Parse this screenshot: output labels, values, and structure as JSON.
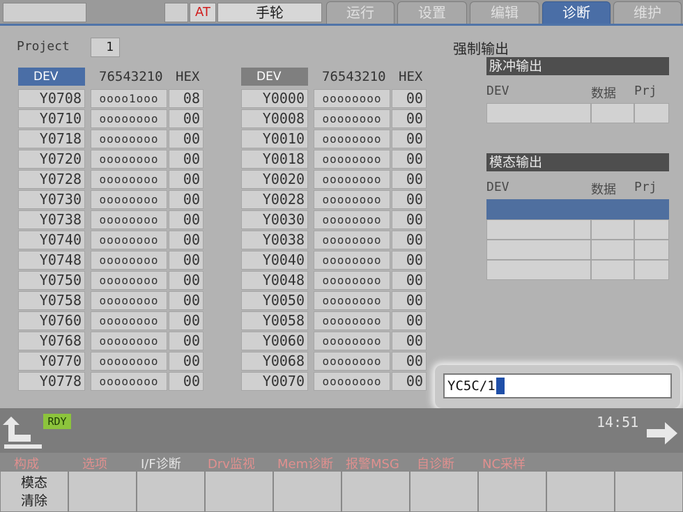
{
  "topbar": {
    "at_label": "AT",
    "mode_label": "手轮",
    "tabs": [
      {
        "label": "运行",
        "active": false
      },
      {
        "label": "设置",
        "active": false
      },
      {
        "label": "编辑",
        "active": false
      },
      {
        "label": "诊断",
        "active": true
      },
      {
        "label": "维护",
        "active": false
      }
    ]
  },
  "project": {
    "label": "Project",
    "value": "1"
  },
  "io_left": {
    "headers": {
      "dev": "DEV",
      "bits": "76543210",
      "hex": "HEX"
    },
    "rows": [
      {
        "dev": "Y0708",
        "bits": "oooo1ooo",
        "hex": "08"
      },
      {
        "dev": "Y0710",
        "bits": "oooooooo",
        "hex": "00"
      },
      {
        "dev": "Y0718",
        "bits": "oooooooo",
        "hex": "00"
      },
      {
        "dev": "Y0720",
        "bits": "oooooooo",
        "hex": "00"
      },
      {
        "dev": "Y0728",
        "bits": "oooooooo",
        "hex": "00"
      },
      {
        "dev": "Y0730",
        "bits": "oooooooo",
        "hex": "00"
      },
      {
        "dev": "Y0738",
        "bits": "oooooooo",
        "hex": "00"
      },
      {
        "dev": "Y0740",
        "bits": "oooooooo",
        "hex": "00"
      },
      {
        "dev": "Y0748",
        "bits": "oooooooo",
        "hex": "00"
      },
      {
        "dev": "Y0750",
        "bits": "oooooooo",
        "hex": "00"
      },
      {
        "dev": "Y0758",
        "bits": "oooooooo",
        "hex": "00"
      },
      {
        "dev": "Y0760",
        "bits": "oooooooo",
        "hex": "00"
      },
      {
        "dev": "Y0768",
        "bits": "oooooooo",
        "hex": "00"
      },
      {
        "dev": "Y0770",
        "bits": "oooooooo",
        "hex": "00"
      },
      {
        "dev": "Y0778",
        "bits": "oooooooo",
        "hex": "00"
      }
    ]
  },
  "io_right": {
    "headers": {
      "dev": "DEV",
      "bits": "76543210",
      "hex": "HEX"
    },
    "rows": [
      {
        "dev": "Y0000",
        "bits": "oooooooo",
        "hex": "00"
      },
      {
        "dev": "Y0008",
        "bits": "oooooooo",
        "hex": "00"
      },
      {
        "dev": "Y0010",
        "bits": "oooooooo",
        "hex": "00"
      },
      {
        "dev": "Y0018",
        "bits": "oooooooo",
        "hex": "00"
      },
      {
        "dev": "Y0020",
        "bits": "oooooooo",
        "hex": "00"
      },
      {
        "dev": "Y0028",
        "bits": "oooooooo",
        "hex": "00"
      },
      {
        "dev": "Y0030",
        "bits": "oooooooo",
        "hex": "00"
      },
      {
        "dev": "Y0038",
        "bits": "oooooooo",
        "hex": "00"
      },
      {
        "dev": "Y0040",
        "bits": "oooooooo",
        "hex": "00"
      },
      {
        "dev": "Y0048",
        "bits": "oooooooo",
        "hex": "00"
      },
      {
        "dev": "Y0050",
        "bits": "oooooooo",
        "hex": "00"
      },
      {
        "dev": "Y0058",
        "bits": "oooooooo",
        "hex": "00"
      },
      {
        "dev": "Y0060",
        "bits": "oooooooo",
        "hex": "00"
      },
      {
        "dev": "Y0068",
        "bits": "oooooooo",
        "hex": "00"
      },
      {
        "dev": "Y0070",
        "bits": "oooooooo",
        "hex": "00"
      }
    ]
  },
  "forced_output": {
    "title": "强制输出",
    "pulse_section": {
      "title": "脉冲输出",
      "col_dev": "DEV",
      "col_data": "数据",
      "col_prj": "Prj"
    },
    "modal_section": {
      "title": "模态输出",
      "col_dev": "DEV",
      "col_data": "数据",
      "col_prj": "Prj"
    }
  },
  "command_input": {
    "value": "YC5C/1"
  },
  "status": {
    "ready_label": "RDY",
    "time": "14:51"
  },
  "menu_labels": [
    {
      "text": "构成",
      "style": "pink"
    },
    {
      "text": "选项",
      "style": "pink"
    },
    {
      "text": "I/F诊断",
      "style": "white"
    },
    {
      "text": "Drv监视",
      "style": "pink"
    },
    {
      "text": "Mem诊断",
      "style": "pink"
    },
    {
      "text": "报警MSG",
      "style": "pink"
    },
    {
      "text": "自诊断",
      "style": "pink"
    },
    {
      "text": "NC采样",
      "style": "pink"
    }
  ],
  "softkeys": [
    {
      "line1": "模态",
      "line2": "清除"
    },
    {
      "line1": "",
      "line2": ""
    },
    {
      "line1": "",
      "line2": ""
    },
    {
      "line1": "",
      "line2": ""
    },
    {
      "line1": "",
      "line2": ""
    },
    {
      "line1": "",
      "line2": ""
    },
    {
      "line1": "",
      "line2": ""
    },
    {
      "line1": "",
      "line2": ""
    },
    {
      "line1": "",
      "line2": ""
    },
    {
      "line1": "",
      "line2": ""
    }
  ],
  "colors": {
    "accent": "#4a6ea6",
    "ready": "#8cc43c",
    "menu_pink": "#e0908f"
  }
}
